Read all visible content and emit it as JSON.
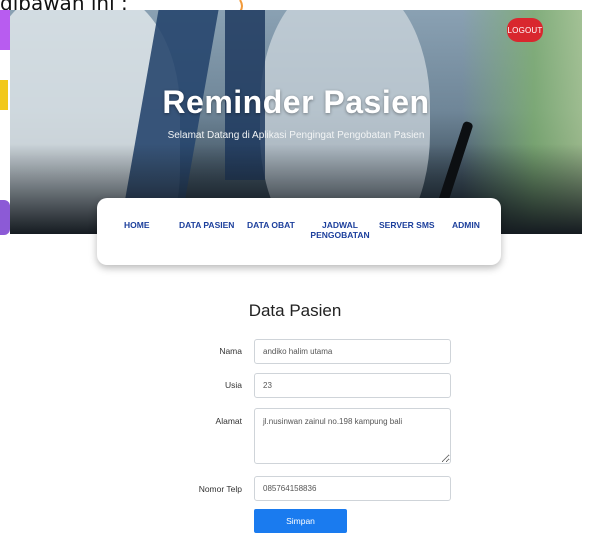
{
  "doc": {
    "partial_text": "dibawah ini :"
  },
  "hero": {
    "title": "Reminder Pasien",
    "subtitle": "Selamat Datang di Aplikasi Pengingat Pengobatan Pasien",
    "logout_label": "LOGOUT"
  },
  "nav": {
    "items": [
      {
        "label": "HOME"
      },
      {
        "label": "DATA PASIEN"
      },
      {
        "label": "DATA OBAT"
      },
      {
        "label": "JADWAL\nPENGOBATAN"
      },
      {
        "label": "SERVER SMS"
      },
      {
        "label": "ADMIN"
      }
    ]
  },
  "form": {
    "title": "Data Pasien",
    "fields": {
      "nama": {
        "label": "Nama",
        "value": "andiko halim utama"
      },
      "usia": {
        "label": "Usia",
        "value": "23"
      },
      "alamat": {
        "label": "Alamat",
        "value": "jl.nusinwan zainul no.198 kampung bali"
      },
      "telp": {
        "label": "Nomor Telp",
        "value": "085764158836"
      }
    },
    "submit_label": "Simpan"
  },
  "colors": {
    "nav_text": "#1c3f9c",
    "logout": "#d9272e",
    "submit": "#1a7bef"
  }
}
